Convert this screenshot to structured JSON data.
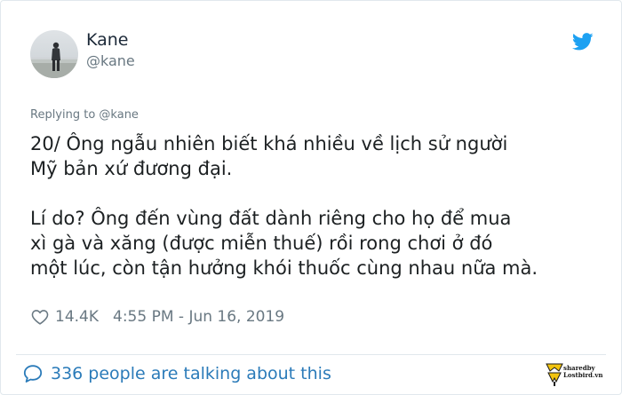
{
  "author": {
    "name": "Kane",
    "handle": "@kane"
  },
  "reply_to": "Replying to @kane",
  "tweet": {
    "paragraph_1": "20/ Ông ngẫu nhiên biết khá nhiều về lịch sử người\nMỹ bản xứ đương đại.",
    "paragraph_2": "Lí do? Ông đến vùng đất dành riêng cho họ để mua\nxì gà và xăng (được miễn thuế) rồi rong chơi ở đó\nmột lúc, còn tận hưởng khói thuốc cùng nhau nữa mà."
  },
  "meta": {
    "likes": "14.4K",
    "timestamp": "4:55 PM - Jun 16, 2019"
  },
  "footer": {
    "talking": "336 people are talking about this"
  },
  "watermark": {
    "line_1": "sharedby",
    "line_2": "Lostbird.vn"
  },
  "colors": {
    "twitter_blue": "#1da1f2",
    "link_blue": "#2b7bb9",
    "muted": "#697882",
    "text": "#1c2022"
  },
  "icons": {
    "brand": "twitter-bird-icon",
    "like": "heart-icon",
    "conversation": "speech-bubble-icon"
  }
}
